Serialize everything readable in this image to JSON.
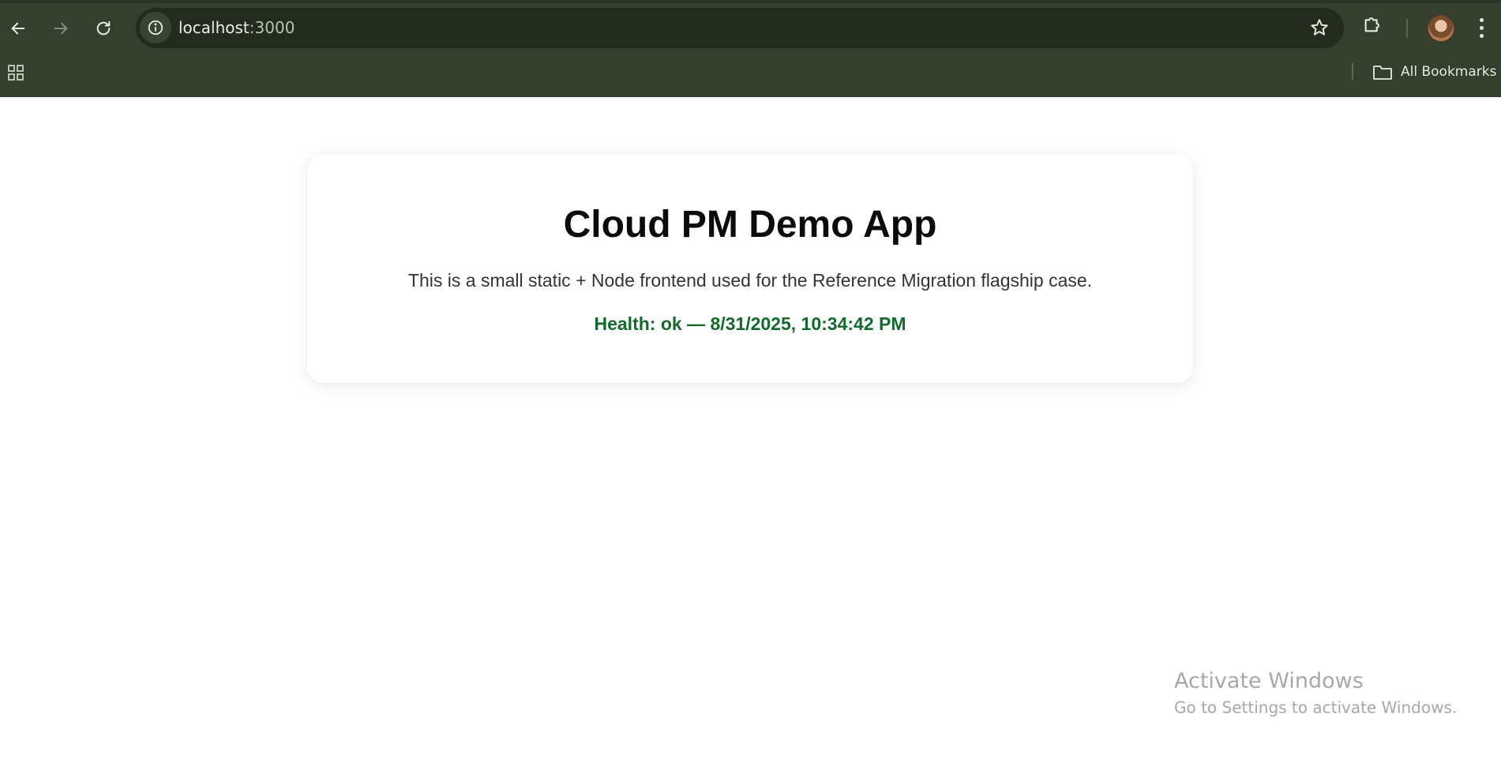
{
  "browser": {
    "url_host": "localhost",
    "url_port": ":3000",
    "bookmarks_label": "All Bookmarks",
    "icons": {
      "back": "back-arrow-icon",
      "forward": "forward-arrow-icon",
      "reload": "reload-icon",
      "site_info": "info-icon",
      "bookmark_star": "star-icon",
      "extensions": "puzzle-icon",
      "profile": "avatar",
      "menu": "kebab-menu-icon",
      "apps": "apps-grid-icon",
      "bookmarks_folder": "folder-icon"
    },
    "colors": {
      "chrome_bg": "#353f2e",
      "omnibox_bg": "#222b1d"
    }
  },
  "page": {
    "title": "Cloud PM Demo App",
    "description": "This is a small static + Node frontend used for the Reference Migration flagship case.",
    "health": "Health: ok — 8/31/2025, 10:34:42 PM",
    "colors": {
      "health": "#136b2b",
      "title": "#0b0b0b",
      "card_bg": "#ffffff"
    }
  },
  "watermark": {
    "title": "Activate Windows",
    "subtitle": "Go to Settings to activate Windows."
  }
}
